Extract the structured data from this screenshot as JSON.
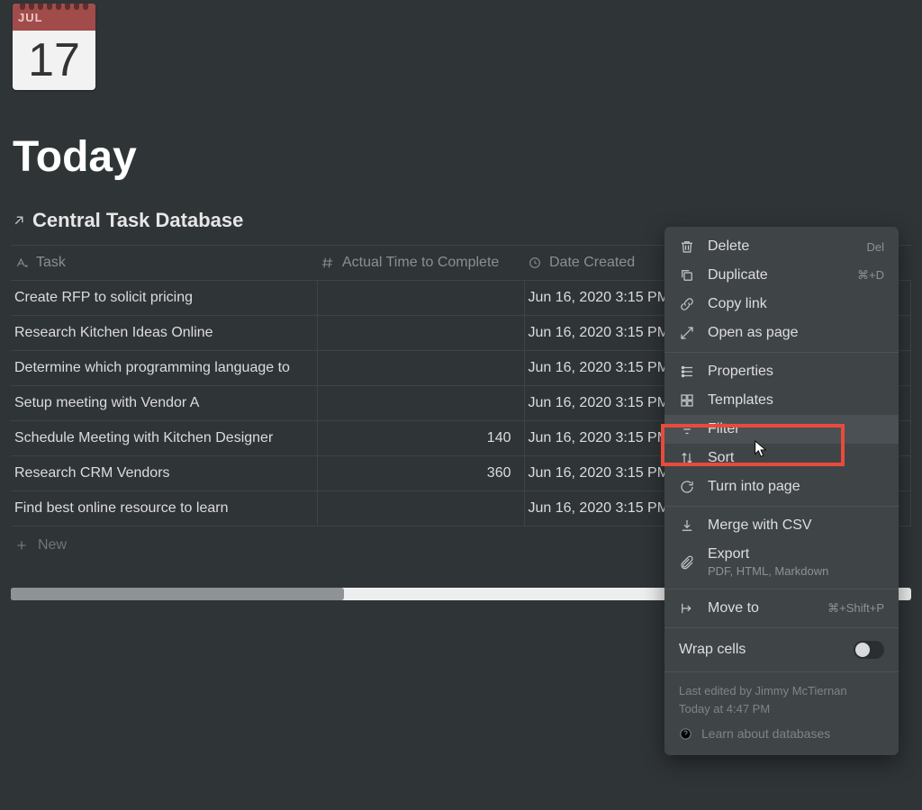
{
  "calendar": {
    "month": "JUL",
    "day": "17"
  },
  "page_title": "Today",
  "database": {
    "title": "Central Task Database",
    "columns": {
      "task": "Task",
      "actual_time": "Actual Time to Complete",
      "date_created": "Date Created"
    },
    "rows": [
      {
        "task": "Create RFP to solicit pricing",
        "actual_time": "",
        "date_created": "Jun 16, 2020 3:15 PM"
      },
      {
        "task": "Research Kitchen Ideas Online",
        "actual_time": "",
        "date_created": "Jun 16, 2020 3:15 PM"
      },
      {
        "task": "Determine which programming language to",
        "actual_time": "",
        "date_created": "Jun 16, 2020 3:15 PM"
      },
      {
        "task": "Setup meeting with Vendor A",
        "actual_time": "",
        "date_created": "Jun 16, 2020 3:15 PM"
      },
      {
        "task": "Schedule Meeting with Kitchen Designer",
        "actual_time": "140",
        "date_created": "Jun 16, 2020 3:15 PM"
      },
      {
        "task": "Research CRM Vendors",
        "actual_time": "360",
        "date_created": "Jun 16, 2020 3:15 PM"
      },
      {
        "task": "Find best online resource to learn",
        "actual_time": "",
        "date_created": "Jun 16, 2020 3:15 PM"
      }
    ],
    "new_label": "New"
  },
  "menu": {
    "delete": {
      "label": "Delete",
      "kbd": "Del"
    },
    "duplicate": {
      "label": "Duplicate",
      "kbd": "⌘+D"
    },
    "copy_link": "Copy link",
    "open_as_page": "Open as page",
    "properties": "Properties",
    "templates": "Templates",
    "filter": "Filter",
    "sort": "Sort",
    "turn_into_page": "Turn into page",
    "merge_csv": "Merge with CSV",
    "export": {
      "label": "Export",
      "sub": "PDF, HTML, Markdown"
    },
    "move_to": {
      "label": "Move to",
      "kbd": "⌘+Shift+P"
    },
    "wrap_cells": "Wrap cells",
    "last_edited_by": "Last edited by Jimmy McTiernan",
    "last_edited_at": "Today at 4:47 PM",
    "learn": "Learn about databases"
  }
}
